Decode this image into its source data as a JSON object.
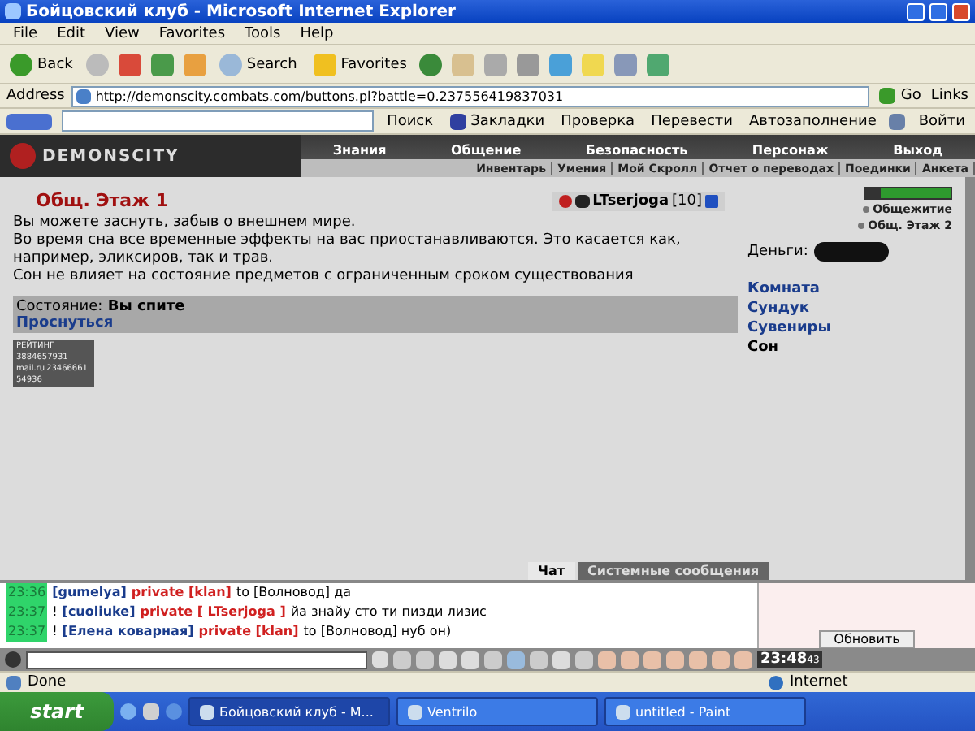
{
  "window": {
    "title": "Бойцовский клуб - Microsoft Internet Explorer"
  },
  "menu": [
    "File",
    "Edit",
    "View",
    "Favorites",
    "Tools",
    "Help"
  ],
  "toolbar": {
    "back": "Back",
    "search": "Search",
    "favorites": "Favorites"
  },
  "address": {
    "label": "Address",
    "url": "http://demonscity.combats.com/buttons.pl?battle=0.237556419837031",
    "go": "Go",
    "links": "Links"
  },
  "google_bar": {
    "search": "Поиск",
    "bookmarks": "Закладки",
    "check": "Проверка",
    "translate": "Перевести",
    "autofill": "Автозаполнение",
    "signin": "Войти"
  },
  "game": {
    "logo": "DEMONSCITY",
    "nav": [
      "Знания",
      "Общение",
      "Безопасность",
      "Персонаж",
      "Выход"
    ],
    "subnav": [
      "Инвентарь",
      "Умения",
      "Мой Скролл",
      "Отчет о переводах",
      "Поединки",
      "Анкета"
    ],
    "location": "Общ. Этаж 1",
    "user": "LTserjoga",
    "level": "[10]",
    "paragraphs": [
      "Вы можете заснуть, забыв о внешнем мире.",
      "Во время сна все временные эффекты на вас приостанавливаются. Это касается как, например, эликсиров, так и трав.",
      "Сон не влияет на состояние предметов с ограниченным сроком существования"
    ],
    "status_label": "Состояние:",
    "status_value": "Вы спите",
    "wake": "Проснуться",
    "counter": [
      "РЕЙТИНГ",
      "3884657931",
      "mail.ru",
      "23466661",
      "54936"
    ],
    "exits": [
      "Общежитие",
      "Общ. Этаж 2"
    ],
    "money_label": "Деньги:",
    "rooms": [
      {
        "label": "Комната",
        "selected": false
      },
      {
        "label": "Сундук",
        "selected": false
      },
      {
        "label": "Сувениры",
        "selected": false
      },
      {
        "label": "Сон",
        "selected": true
      }
    ]
  },
  "chat": {
    "messages": [
      {
        "time": "23:36",
        "sender": "[gumelya]",
        "channel": "private [klan]",
        "text": "to [Волновод] да"
      },
      {
        "time": "23:37",
        "mark": "!",
        "sender": "[cuoliuke]",
        "channel": "private [ LTserjoga ]",
        "text": "йа знайу сто ти пизди лизис"
      },
      {
        "time": "23:37",
        "mark": "!",
        "sender": "[Елена коварная]",
        "channel": "private [klan]",
        "text": "to [Волновод] нуб он)"
      }
    ],
    "tabs": [
      {
        "label": "Чат",
        "selected": true
      },
      {
        "label": "Системные сообщения",
        "selected": false
      }
    ],
    "refresh": "Обновить",
    "clock": "23:48",
    "seconds": "43"
  },
  "status_bar": {
    "left": "Done",
    "zone": "Internet"
  },
  "taskbar": {
    "start": "start",
    "tasks": [
      {
        "label": "Бойцовский клуб - M...",
        "selected": true
      },
      {
        "label": "Ventrilo",
        "selected": false
      },
      {
        "label": "untitled - Paint",
        "selected": false
      }
    ]
  }
}
